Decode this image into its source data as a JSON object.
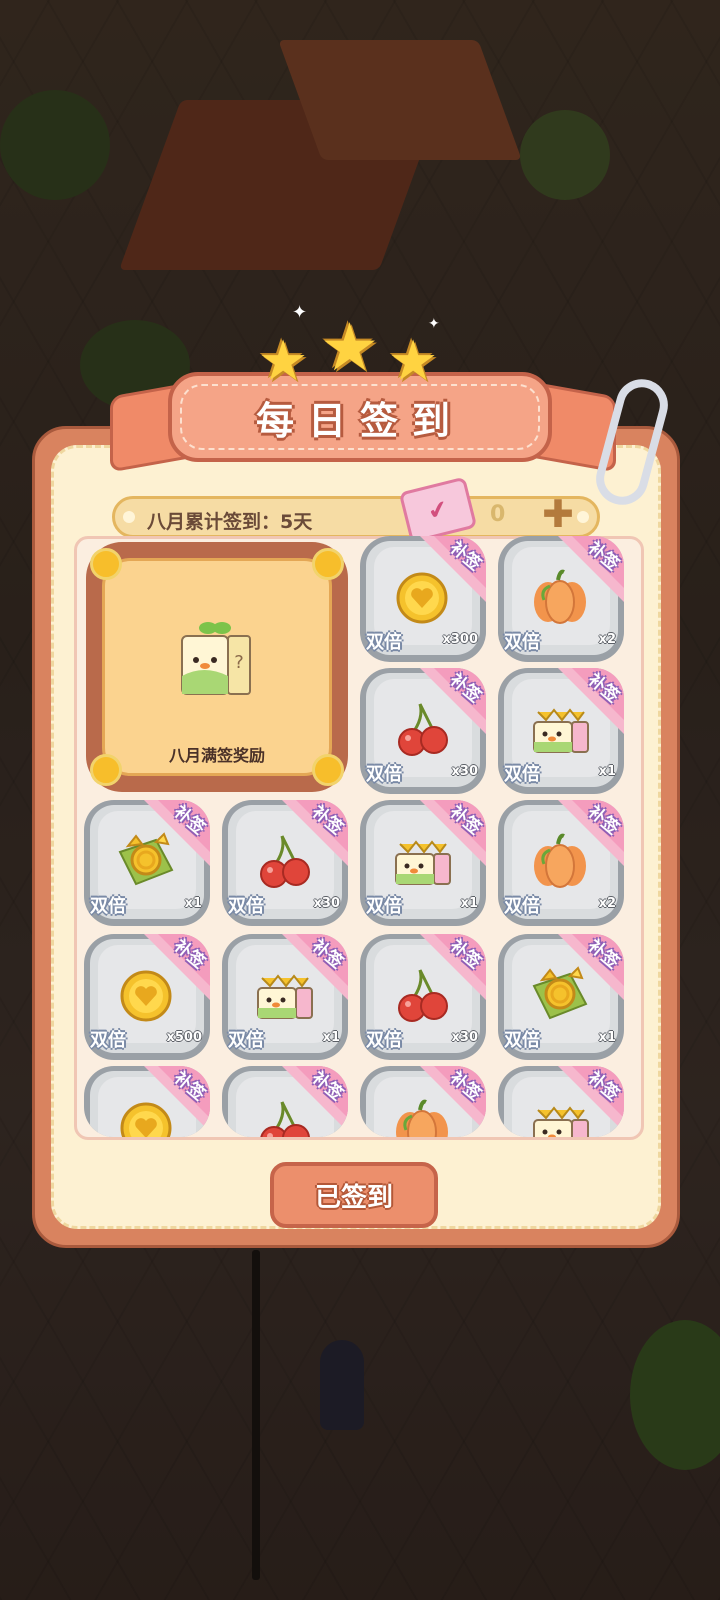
{
  "title": "每日签到",
  "summary": {
    "label": "八月累计签到：5天",
    "ticket_count": "0"
  },
  "big_reward": {
    "label": "八月满签奖励"
  },
  "tag_label": "补签",
  "double_label": "双倍",
  "days": [
    {
      "icon": "coin",
      "qty": "x300"
    },
    {
      "icon": "pumpkin",
      "qty": "x2"
    },
    {
      "icon": "cherry",
      "qty": "x30"
    },
    {
      "icon": "gift-box",
      "qty": "x1"
    },
    {
      "icon": "gold-pieces",
      "qty": "x1"
    },
    {
      "icon": "cherry",
      "qty": "x30"
    },
    {
      "icon": "gift-box",
      "qty": "x1"
    },
    {
      "icon": "pumpkin",
      "qty": "x2"
    },
    {
      "icon": "coin",
      "qty": "x500"
    },
    {
      "icon": "gift-box",
      "qty": "x1"
    },
    {
      "icon": "cherry",
      "qty": "x30"
    },
    {
      "icon": "gold-pieces",
      "qty": "x1"
    },
    {
      "icon": "coin",
      "qty": ""
    },
    {
      "icon": "cherry",
      "qty": ""
    },
    {
      "icon": "pumpkin",
      "qty": ""
    },
    {
      "icon": "gift-box",
      "qty": ""
    }
  ],
  "signed_button": "已签到",
  "colors": {
    "panel": "#d9835f",
    "panel_inner": "#fdf1d2",
    "ribbon": "#f5a487",
    "tag": "#f6b7cd",
    "tag_text_outline": "#8e5fb6",
    "cell": "#e6e7e9"
  }
}
